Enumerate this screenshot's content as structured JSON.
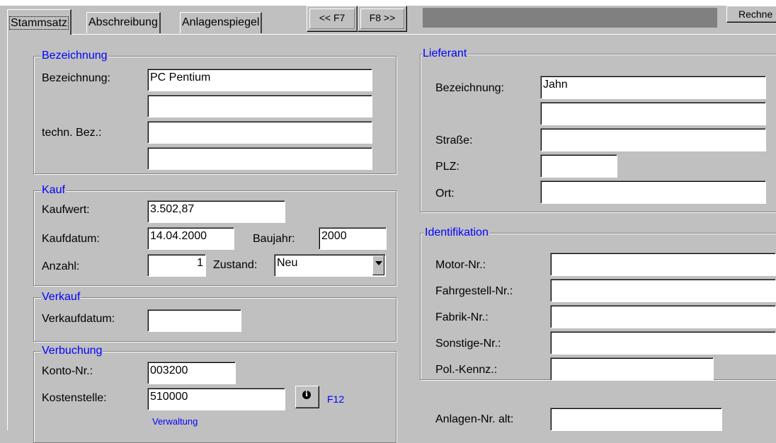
{
  "tabs": [
    {
      "label": "Stammsatz",
      "active": true
    },
    {
      "label": "Abschreibung",
      "active": false
    },
    {
      "label": "Anlagenspiegel",
      "active": false
    }
  ],
  "nav": {
    "prev_label": "<< F7",
    "next_label": "F8 >>"
  },
  "toolbar": {
    "rechnen_label": "Rechne"
  },
  "bezeichnung": {
    "title": "Bezeichnung",
    "bezeichnung_label": "Bezeichnung:",
    "bezeichnung_value": "PC Pentium",
    "bezeichnung2_value": "",
    "techn_label": "techn. Bez.:",
    "techn_value": "",
    "techn2_value": ""
  },
  "kauf": {
    "title": "Kauf",
    "kaufwert_label": "Kaufwert:",
    "kaufwert_value": "3.502,87",
    "kaufdatum_label": "Kaufdatum:",
    "kaufdatum_value": "14.04.2000",
    "baujahr_label": "Baujahr:",
    "baujahr_value": "2000",
    "anzahl_label": "Anzahl:",
    "anzahl_value": "1",
    "zustand_label": "Zustand:",
    "zustand_value": "Neu"
  },
  "verkauf": {
    "title": "Verkauf",
    "verkaufdatum_label": "Verkaufdatum:",
    "verkaufdatum_value": ""
  },
  "verbuchung": {
    "title": "Verbuchung",
    "konto_label": "Konto-Nr.:",
    "konto_value": "003200",
    "kostenstelle_label": "Kostenstelle:",
    "kostenstelle_value": "510000",
    "info_icon": "info-icon",
    "f12_label": "F12",
    "kostenstelle_name": "Verwaltung"
  },
  "lieferant": {
    "title": "Lieferant",
    "bezeichnung_label": "Bezeichnung:",
    "bezeichnung_value": "Jahn",
    "bezeichnung2_value": "",
    "strasse_label": "Straße:",
    "strasse_value": "",
    "plz_label": "PLZ:",
    "plz_value": "",
    "ort_label": "Ort:",
    "ort_value": ""
  },
  "identifikation": {
    "title": "Identifikation",
    "motor_label": "Motor-Nr.:",
    "motor_value": "",
    "fahrgestell_label": "Fahrgestell-Nr.:",
    "fahrgestell_value": "",
    "fabrik_label": "Fabrik-Nr.:",
    "fabrik_value": "",
    "sonstige_label": "Sonstige-Nr.:",
    "sonstige_value": "",
    "pol_label": "Pol.-Kennz.:",
    "pol_value": ""
  },
  "anlagen_alt": {
    "label": "Anlagen-Nr. alt:",
    "value": ""
  },
  "colors": {
    "background": "#c0c0c0",
    "legend": "#0000ff",
    "bar": "#808080"
  }
}
